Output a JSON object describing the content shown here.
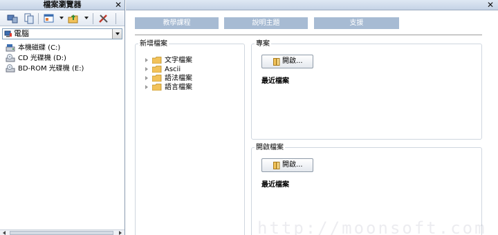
{
  "file_browser": {
    "title": "檔案瀏覽器",
    "close_glyph": "✕",
    "toolbar_icons": [
      "computer-icon",
      "copy-icon",
      "view-icon",
      "upload-icon",
      "tools-icon"
    ],
    "drive_select_value": "電腦",
    "drives": [
      {
        "label": "本機磁碟 (C:)",
        "icon": "hard-disk-icon"
      },
      {
        "label": "CD 光碟機 (D:)",
        "icon": "cd-drive-icon"
      },
      {
        "label": "BD-ROM 光碟機 (E:)",
        "icon": "cd-drive-icon"
      }
    ],
    "scrollbar_grip": "⦙⦙⦙"
  },
  "main": {
    "close_glyph": "✕",
    "tabs": [
      {
        "label": "教學課程"
      },
      {
        "label": "說明主題"
      },
      {
        "label": "支援"
      }
    ],
    "new_file": {
      "title": "新增檔案",
      "items": [
        {
          "label": "文字檔案"
        },
        {
          "label": "Ascii"
        },
        {
          "label": "語法檔案"
        },
        {
          "label": "語言檔案"
        }
      ]
    },
    "project": {
      "title": "專案",
      "open_button": "開啟...",
      "recent_label": "最近檔案"
    },
    "open_file": {
      "title": "開啟檔案",
      "open_button": "開啟...",
      "recent_label": "最近檔案"
    },
    "watermark": "http://moonsoft.com"
  },
  "colors": {
    "tab_bg": "#a7bbd3",
    "titlebar": "#c5d3e6",
    "folder": "#f2c25a"
  }
}
